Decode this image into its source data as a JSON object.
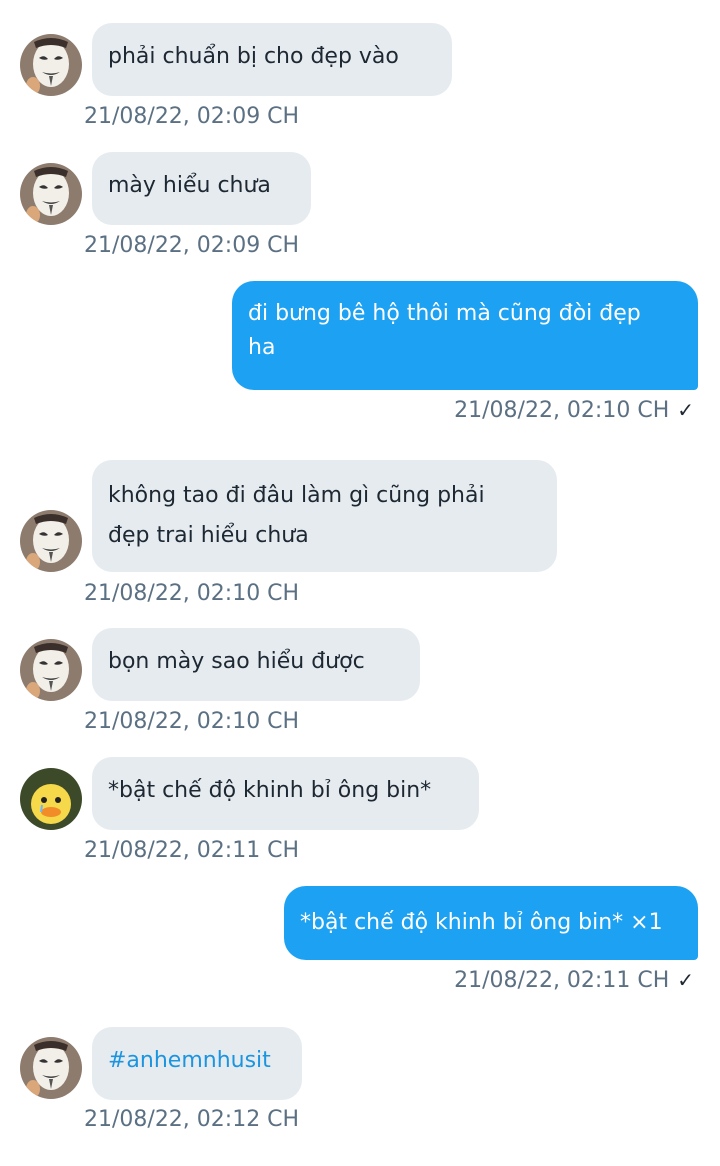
{
  "messages": [
    {
      "side": "in",
      "avatar": "mask",
      "text": "phải chuẩn bị cho đẹp vào",
      "time": "21/08/22,  02:09 CH"
    },
    {
      "side": "in",
      "avatar": "mask",
      "text": "mày hiểu chưa",
      "time": "21/08/22,  02:09 CH"
    },
    {
      "side": "out",
      "text_line1": "đi bưng bê hộ thôi mà cũng đòi đẹp",
      "text_line2": "ha",
      "time": "21/08/22,  02:10 CH",
      "status_icon": "check-icon"
    },
    {
      "side": "in",
      "avatar": "mask",
      "text_line1": "không tao đi đâu làm gì cũng phải",
      "text_line2": "đẹp trai hiểu chưa",
      "time": "21/08/22,  02:10 CH"
    },
    {
      "side": "in",
      "avatar": "mask",
      "text": "bọn mày sao hiểu được",
      "time": "21/08/22,  02:10 CH"
    },
    {
      "side": "in",
      "avatar": "duck",
      "text": "*bật chế độ khinh bỉ ông bin*",
      "time": "21/08/22,  02:11 CH"
    },
    {
      "side": "out",
      "text": "*bật chế độ khinh bỉ ông bin* ×1",
      "time": "21/08/22,  02:11 CH",
      "status_icon": "check-icon"
    },
    {
      "side": "in",
      "avatar": "mask",
      "text": "#anhemnhusit",
      "time": "21/08/22,  02:12 CH",
      "is_hashtag": true
    }
  ],
  "check_glyph": "✓",
  "colors": {
    "incoming_bubble": "#e6ebef",
    "outgoing_bubble": "#1da1f2",
    "timestamp": "#5b7083",
    "hashtag": "#1b95e0"
  }
}
